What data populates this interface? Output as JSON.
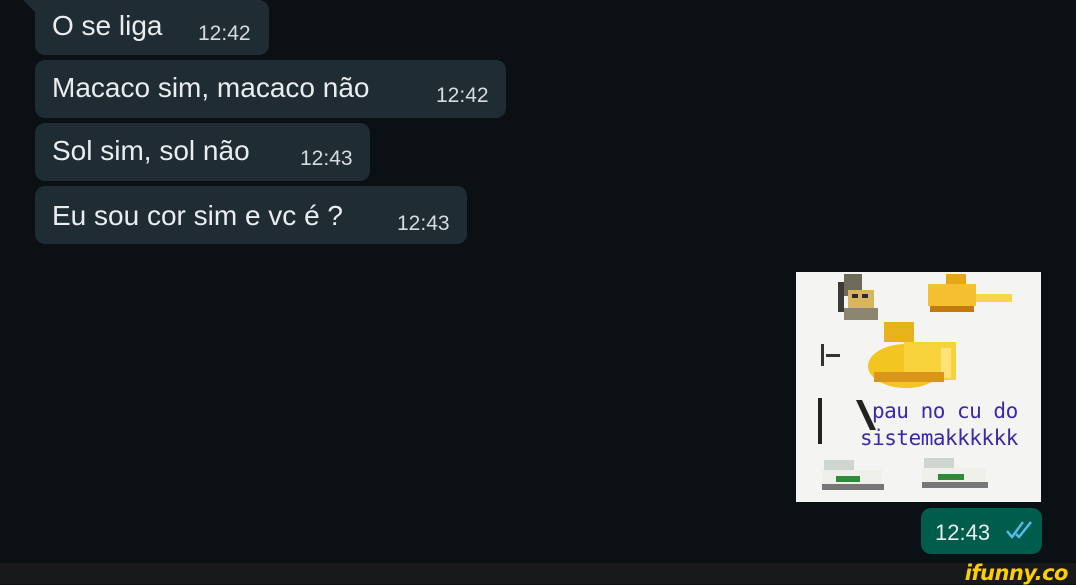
{
  "messages": [
    {
      "text": "O se liga",
      "time": "12:42"
    },
    {
      "text": "Macaco sim, macaco não",
      "time": "12:42"
    },
    {
      "text": "Sol sim, sol não",
      "time": "12:43"
    },
    {
      "text": "Eu sou cor sim e vc é ?",
      "time": "12:43"
    }
  ],
  "outgoing": {
    "sticker_caption_line1": "pau no cu do",
    "sticker_caption_line2": "sistemakkkkkk",
    "time": "12:43",
    "status_icon": "double-check-read-icon"
  },
  "watermark": "ifunny.co",
  "colors": {
    "background": "#0b1014",
    "incoming_bubble": "#1f2c33",
    "outgoing_bubble": "#005c4b",
    "read_ticks": "#53bdeb",
    "watermark": "#ffce00"
  }
}
